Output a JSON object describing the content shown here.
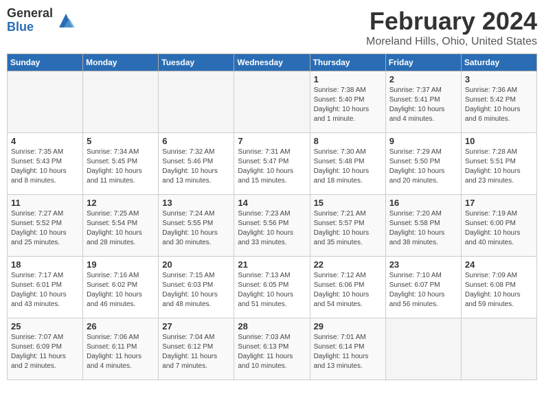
{
  "logo": {
    "general": "General",
    "blue": "Blue"
  },
  "header": {
    "month": "February 2024",
    "location": "Moreland Hills, Ohio, United States"
  },
  "days_of_week": [
    "Sunday",
    "Monday",
    "Tuesday",
    "Wednesday",
    "Thursday",
    "Friday",
    "Saturday"
  ],
  "weeks": [
    [
      {
        "day": "",
        "info": ""
      },
      {
        "day": "",
        "info": ""
      },
      {
        "day": "",
        "info": ""
      },
      {
        "day": "",
        "info": ""
      },
      {
        "day": "1",
        "info": "Sunrise: 7:38 AM\nSunset: 5:40 PM\nDaylight: 10 hours\nand 1 minute."
      },
      {
        "day": "2",
        "info": "Sunrise: 7:37 AM\nSunset: 5:41 PM\nDaylight: 10 hours\nand 4 minutes."
      },
      {
        "day": "3",
        "info": "Sunrise: 7:36 AM\nSunset: 5:42 PM\nDaylight: 10 hours\nand 6 minutes."
      }
    ],
    [
      {
        "day": "4",
        "info": "Sunrise: 7:35 AM\nSunset: 5:43 PM\nDaylight: 10 hours\nand 8 minutes."
      },
      {
        "day": "5",
        "info": "Sunrise: 7:34 AM\nSunset: 5:45 PM\nDaylight: 10 hours\nand 11 minutes."
      },
      {
        "day": "6",
        "info": "Sunrise: 7:32 AM\nSunset: 5:46 PM\nDaylight: 10 hours\nand 13 minutes."
      },
      {
        "day": "7",
        "info": "Sunrise: 7:31 AM\nSunset: 5:47 PM\nDaylight: 10 hours\nand 15 minutes."
      },
      {
        "day": "8",
        "info": "Sunrise: 7:30 AM\nSunset: 5:48 PM\nDaylight: 10 hours\nand 18 minutes."
      },
      {
        "day": "9",
        "info": "Sunrise: 7:29 AM\nSunset: 5:50 PM\nDaylight: 10 hours\nand 20 minutes."
      },
      {
        "day": "10",
        "info": "Sunrise: 7:28 AM\nSunset: 5:51 PM\nDaylight: 10 hours\nand 23 minutes."
      }
    ],
    [
      {
        "day": "11",
        "info": "Sunrise: 7:27 AM\nSunset: 5:52 PM\nDaylight: 10 hours\nand 25 minutes."
      },
      {
        "day": "12",
        "info": "Sunrise: 7:25 AM\nSunset: 5:54 PM\nDaylight: 10 hours\nand 28 minutes."
      },
      {
        "day": "13",
        "info": "Sunrise: 7:24 AM\nSunset: 5:55 PM\nDaylight: 10 hours\nand 30 minutes."
      },
      {
        "day": "14",
        "info": "Sunrise: 7:23 AM\nSunset: 5:56 PM\nDaylight: 10 hours\nand 33 minutes."
      },
      {
        "day": "15",
        "info": "Sunrise: 7:21 AM\nSunset: 5:57 PM\nDaylight: 10 hours\nand 35 minutes."
      },
      {
        "day": "16",
        "info": "Sunrise: 7:20 AM\nSunset: 5:58 PM\nDaylight: 10 hours\nand 38 minutes."
      },
      {
        "day": "17",
        "info": "Sunrise: 7:19 AM\nSunset: 6:00 PM\nDaylight: 10 hours\nand 40 minutes."
      }
    ],
    [
      {
        "day": "18",
        "info": "Sunrise: 7:17 AM\nSunset: 6:01 PM\nDaylight: 10 hours\nand 43 minutes."
      },
      {
        "day": "19",
        "info": "Sunrise: 7:16 AM\nSunset: 6:02 PM\nDaylight: 10 hours\nand 46 minutes."
      },
      {
        "day": "20",
        "info": "Sunrise: 7:15 AM\nSunset: 6:03 PM\nDaylight: 10 hours\nand 48 minutes."
      },
      {
        "day": "21",
        "info": "Sunrise: 7:13 AM\nSunset: 6:05 PM\nDaylight: 10 hours\nand 51 minutes."
      },
      {
        "day": "22",
        "info": "Sunrise: 7:12 AM\nSunset: 6:06 PM\nDaylight: 10 hours\nand 54 minutes."
      },
      {
        "day": "23",
        "info": "Sunrise: 7:10 AM\nSunset: 6:07 PM\nDaylight: 10 hours\nand 56 minutes."
      },
      {
        "day": "24",
        "info": "Sunrise: 7:09 AM\nSunset: 6:08 PM\nDaylight: 10 hours\nand 59 minutes."
      }
    ],
    [
      {
        "day": "25",
        "info": "Sunrise: 7:07 AM\nSunset: 6:09 PM\nDaylight: 11 hours\nand 2 minutes."
      },
      {
        "day": "26",
        "info": "Sunrise: 7:06 AM\nSunset: 6:11 PM\nDaylight: 11 hours\nand 4 minutes."
      },
      {
        "day": "27",
        "info": "Sunrise: 7:04 AM\nSunset: 6:12 PM\nDaylight: 11 hours\nand 7 minutes."
      },
      {
        "day": "28",
        "info": "Sunrise: 7:03 AM\nSunset: 6:13 PM\nDaylight: 11 hours\nand 10 minutes."
      },
      {
        "day": "29",
        "info": "Sunrise: 7:01 AM\nSunset: 6:14 PM\nDaylight: 11 hours\nand 13 minutes."
      },
      {
        "day": "",
        "info": ""
      },
      {
        "day": "",
        "info": ""
      }
    ]
  ]
}
